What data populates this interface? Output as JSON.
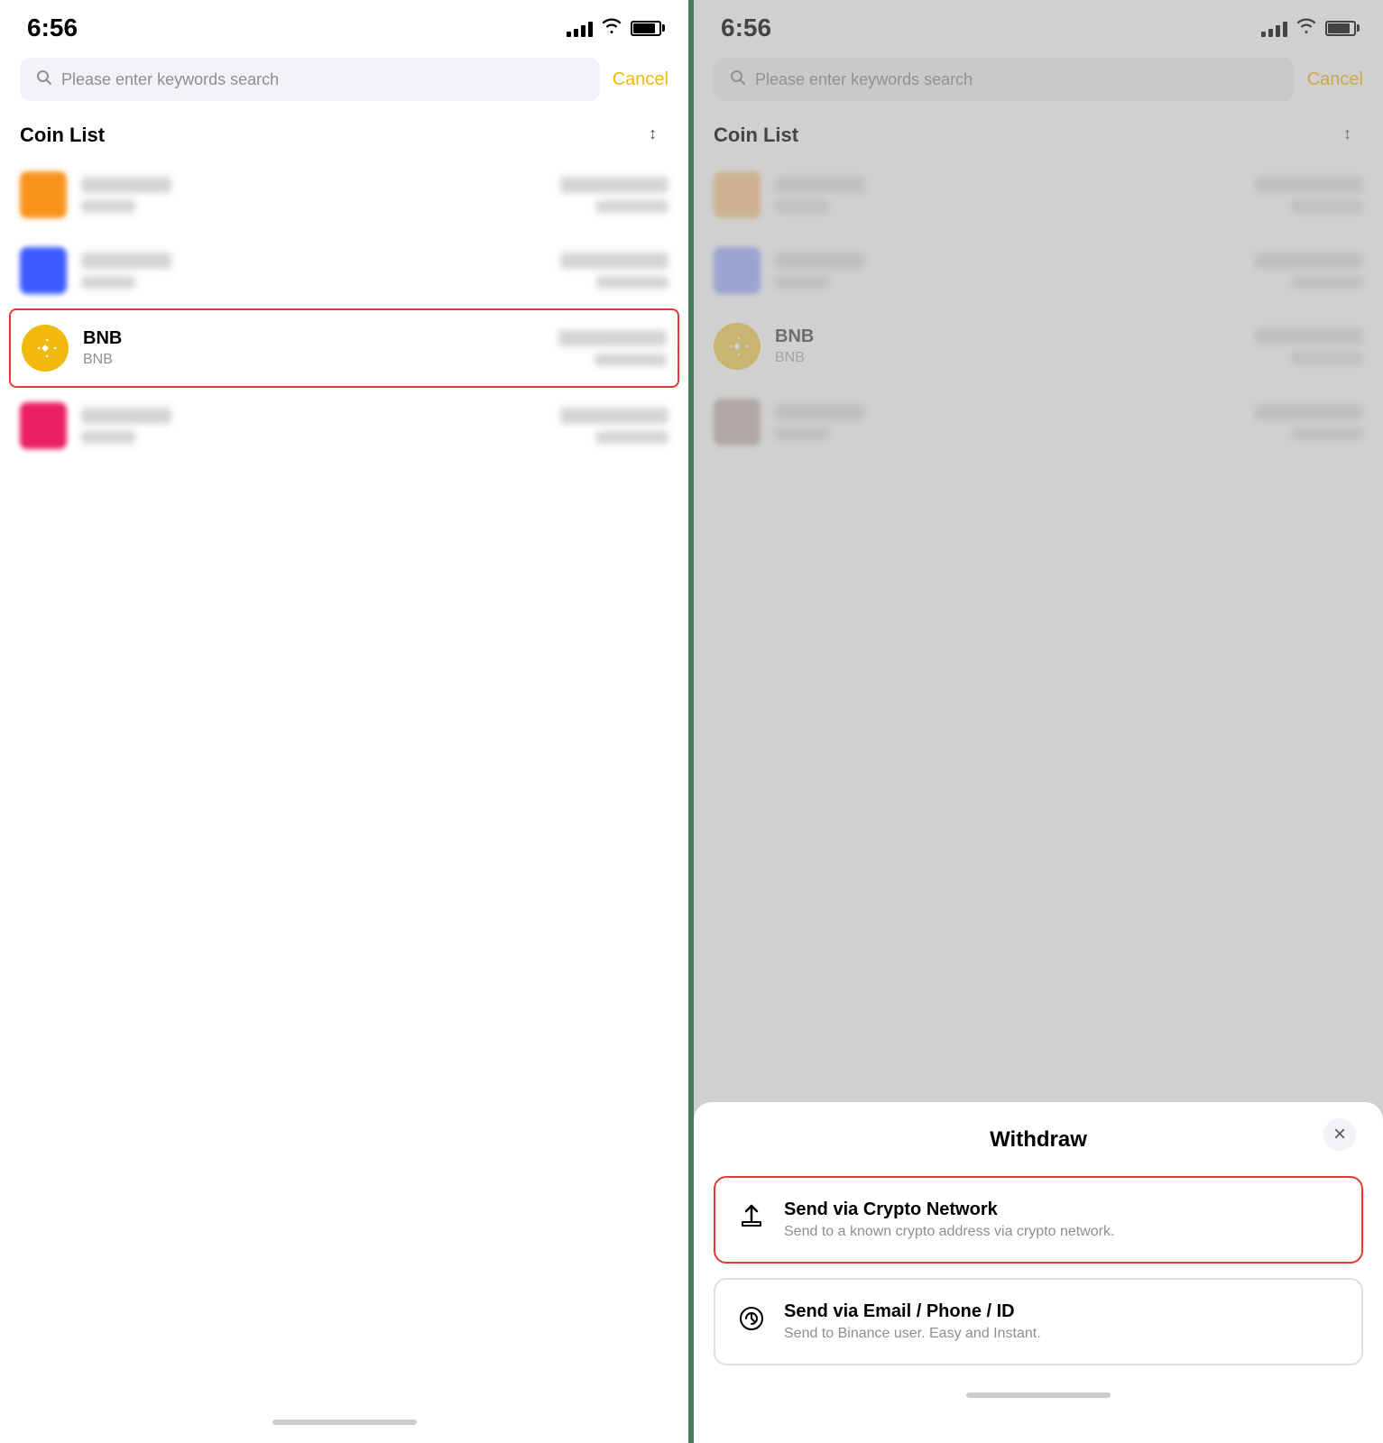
{
  "left_panel": {
    "status_bar": {
      "time": "6:56"
    },
    "search": {
      "placeholder": "Please enter keywords search",
      "cancel_label": "Cancel"
    },
    "coin_list": {
      "title": "Coin List",
      "coins": [
        {
          "id": "coin1",
          "icon_type": "orange",
          "highlighted": false
        },
        {
          "id": "coin2",
          "icon_type": "blue",
          "highlighted": false
        },
        {
          "id": "bnb",
          "name": "BNB",
          "symbol": "BNB",
          "icon_type": "bnb",
          "highlighted": true
        },
        {
          "id": "coin4",
          "icon_type": "pink",
          "highlighted": false
        }
      ]
    },
    "home_indicator": true
  },
  "right_panel": {
    "status_bar": {
      "time": "6:56"
    },
    "search": {
      "placeholder": "Please enter keywords search",
      "cancel_label": "Cancel"
    },
    "coin_list": {
      "title": "Coin List",
      "coins": [
        {
          "id": "coin1",
          "icon_type": "orange"
        },
        {
          "id": "coin2",
          "icon_type": "blue"
        },
        {
          "id": "bnb",
          "name": "BNB",
          "symbol": "BNB",
          "icon_type": "bnb"
        },
        {
          "id": "coin4",
          "icon_type": "brown"
        }
      ]
    },
    "bottom_sheet": {
      "title": "Withdraw",
      "close_label": "×",
      "options": [
        {
          "id": "crypto-network",
          "title": "Send via Crypto Network",
          "subtitle": "Send to a known crypto address via crypto network.",
          "highlighted": true
        },
        {
          "id": "email-phone",
          "title": "Send via Email / Phone / ID",
          "subtitle": "Send to Binance user. Easy and Instant.",
          "highlighted": false
        }
      ]
    },
    "home_indicator": true
  }
}
